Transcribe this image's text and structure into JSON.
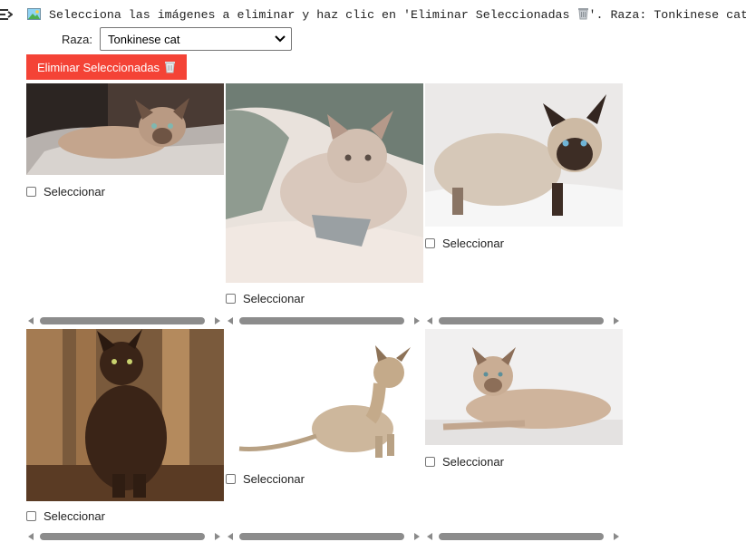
{
  "header": {
    "instructions_text": "Selecciona las imágenes a eliminar y haz clic en 'Eliminar Seleccionadas",
    "instructions_suffix": "'. Raza: Tonkinese cat"
  },
  "breed_selector": {
    "label": "Raza:",
    "selected": "Tonkinese cat"
  },
  "delete_button": {
    "label": "Eliminar Seleccionadas"
  },
  "gallery": {
    "select_label": "Seleccionar",
    "images": [
      {
        "description": "tonkinese cat lying on a blanket"
      },
      {
        "description": "cream kitten curled on a bed"
      },
      {
        "description": "seal point cat on a white rug"
      },
      {
        "description": "chocolate cat sitting by curtains"
      },
      {
        "description": "tonkinese cat sitting on white background"
      },
      {
        "description": "tonkinese cat lying on white background"
      }
    ]
  },
  "colors": {
    "delete_button": "#f44336",
    "scrollbar": "#8c8c8c"
  },
  "icons": [
    "code-cell-output-icon",
    "picture-icon",
    "wastebasket-icon",
    "chevron-down-icon",
    "scroll-left-icon",
    "scroll-right-icon"
  ]
}
